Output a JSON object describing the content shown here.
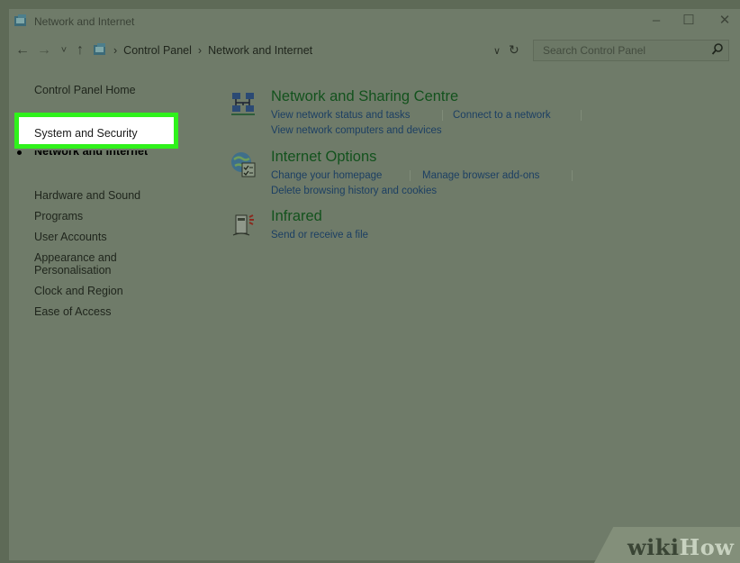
{
  "window": {
    "title": "Network and Internet",
    "minimize_glyph": "–",
    "maximize_glyph": "☐",
    "close_glyph": "✕"
  },
  "address_bar": {
    "back_glyph": "←",
    "forward_glyph": "→",
    "recent_glyph": "˅",
    "up_glyph": "↑",
    "breadcrumb_sep": "›",
    "breadcrumbs": [
      "Control Panel",
      "Network and Internet"
    ],
    "dropdown_glyph": "∨",
    "refresh_glyph": "↻",
    "search_placeholder": "Search Control Panel"
  },
  "sidebar": {
    "home": "Control Panel Home",
    "items": [
      {
        "label": "System and Security"
      },
      {
        "label": "Network and Internet",
        "current": true
      },
      {
        "label": "Hardware and Sound"
      },
      {
        "label": "Programs"
      },
      {
        "label": "User Accounts"
      },
      {
        "label": "Appearance and Personalisation"
      },
      {
        "label": "Clock and Region"
      },
      {
        "label": "Ease of Access"
      }
    ]
  },
  "categories": [
    {
      "title": "Network and Sharing Centre",
      "icon": "network-sharing-icon",
      "links": [
        "View network status and tasks",
        "Connect to a network",
        "View network computers and devices"
      ]
    },
    {
      "title": "Internet Options",
      "icon": "internet-options-icon",
      "links": [
        "Change your homepage",
        "Manage browser add-ons",
        "Delete browsing history and cookies"
      ]
    },
    {
      "title": "Infrared",
      "icon": "infrared-icon",
      "links": [
        "Send or receive a file"
      ]
    }
  ],
  "watermark": {
    "wiki": "wiki",
    "how": "How"
  },
  "colors": {
    "highlight_border": "#2ff21b",
    "category_title": "#13521d",
    "link": "#1c3f63"
  }
}
